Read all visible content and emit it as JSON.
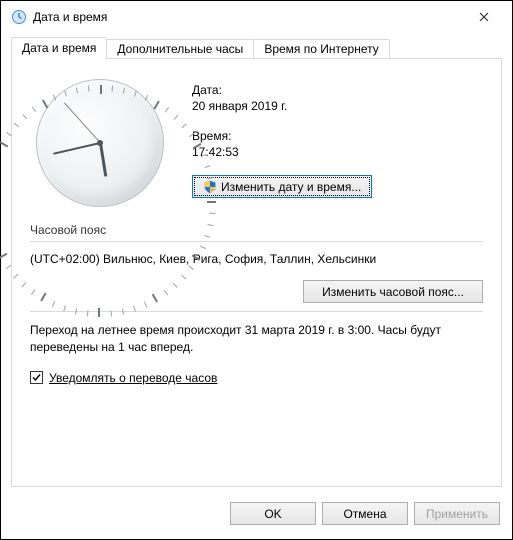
{
  "window": {
    "title": "Дата и время"
  },
  "tabs": {
    "date_time": "Дата и время",
    "additional": "Дополнительные часы",
    "internet": "Время по Интернету"
  },
  "date": {
    "label": "Дата:",
    "value": "20 января 2019 г."
  },
  "time": {
    "label": "Время:",
    "value": "17:42:53",
    "hour_angle": 171,
    "min_angle": 257,
    "sec_angle": 318
  },
  "buttons": {
    "change_date_time": "Изменить дату и время...",
    "change_timezone": "Изменить часовой пояс..."
  },
  "timezone": {
    "label": "Часовой пояс",
    "value": "(UTC+02:00) Вильнюс, Киев, Рига, София, Таллин, Хельсинки"
  },
  "dst": {
    "text": "Переход на летнее время происходит 31 марта 2019 г. в 3:00. Часы будут переведены на 1 час вперед.",
    "checkbox_checked": true,
    "checkbox_label": "Уведомлять о переводе часов"
  },
  "dialog": {
    "ok": "OK",
    "cancel": "Отмена",
    "apply": "Применить"
  }
}
